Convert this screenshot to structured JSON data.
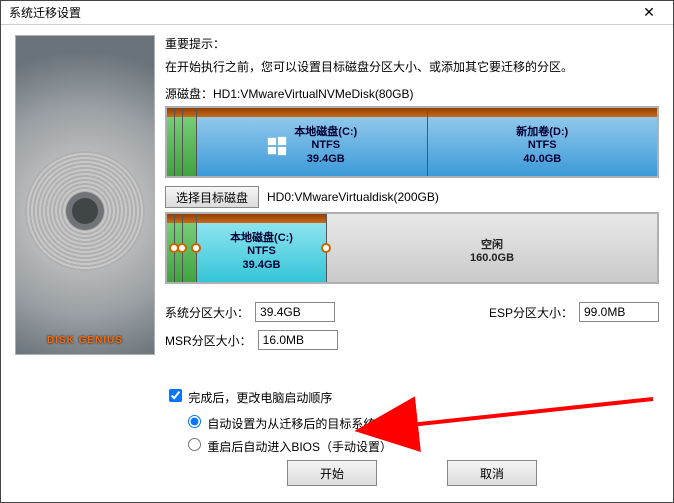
{
  "title": "系统迁移设置",
  "hint": {
    "title": "重要提示：",
    "body": "在开始执行之前，您可以设置目标磁盘分区大小、或添加其它要迁移的分区。"
  },
  "source": {
    "label_prefix": "源磁盘：",
    "disk": "HD1:VMwareVirtualNVMeDisk(80GB)",
    "partitions": [
      {
        "name": "本地磁盘(C:)",
        "fs": "NTFS",
        "size": "39.4GB"
      },
      {
        "name": "新加卷(D:)",
        "fs": "NTFS",
        "size": "40.0GB"
      }
    ]
  },
  "target": {
    "select_btn": "选择目标磁盘",
    "disk": "HD0:VMwareVirtualdisk(200GB)",
    "partitions": [
      {
        "name": "本地磁盘(C:)",
        "fs": "NTFS",
        "size": "39.4GB"
      },
      {
        "name": "空闲",
        "size": "160.0GB"
      }
    ]
  },
  "sizes": {
    "sys_label": "系统分区大小：",
    "sys_value": "39.4GB",
    "esp_label": "ESP分区大小：",
    "esp_value": "99.0MB",
    "msr_label": "MSR分区大小：",
    "msr_value": "16.0MB"
  },
  "options": {
    "checkbox": "完成后，更改电脑启动顺序",
    "radio1": "自动设置为从迁移后的目标系统启动",
    "radio2": "重启后自动进入BIOS（手动设置）"
  },
  "buttons": {
    "start": "开始",
    "cancel": "取消"
  },
  "branding": "DISK GENIUS"
}
